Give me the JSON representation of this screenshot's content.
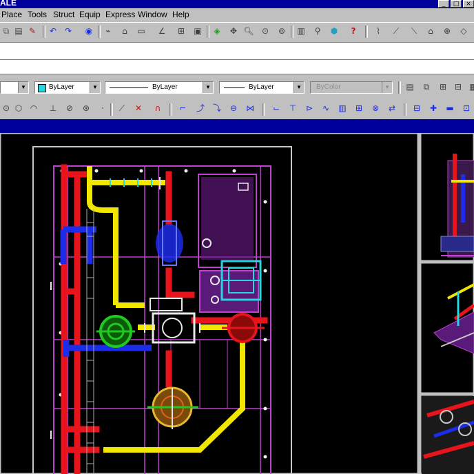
{
  "app": {
    "title": "ALE"
  },
  "menu": [
    "Place",
    "Tools",
    "Struct",
    "Equip",
    "Express",
    "Window",
    "Help"
  ],
  "window_buttons": [
    "_",
    "□",
    "×"
  ],
  "properties": {
    "color": "ByLayer",
    "linetype": "ByLayer",
    "lineweight": "ByLayer",
    "plotstyle": "ByColor"
  },
  "colors": {
    "background": "#000000",
    "chrome": "#c0c0c0",
    "titlebar": "#00009c",
    "pipe_red": "#e8141c",
    "pipe_yellow": "#f0e600",
    "pipe_blue": "#1c2ce8",
    "frame_magenta": "#c040d0",
    "green": "#22c822",
    "cyan": "#26d6e0"
  }
}
